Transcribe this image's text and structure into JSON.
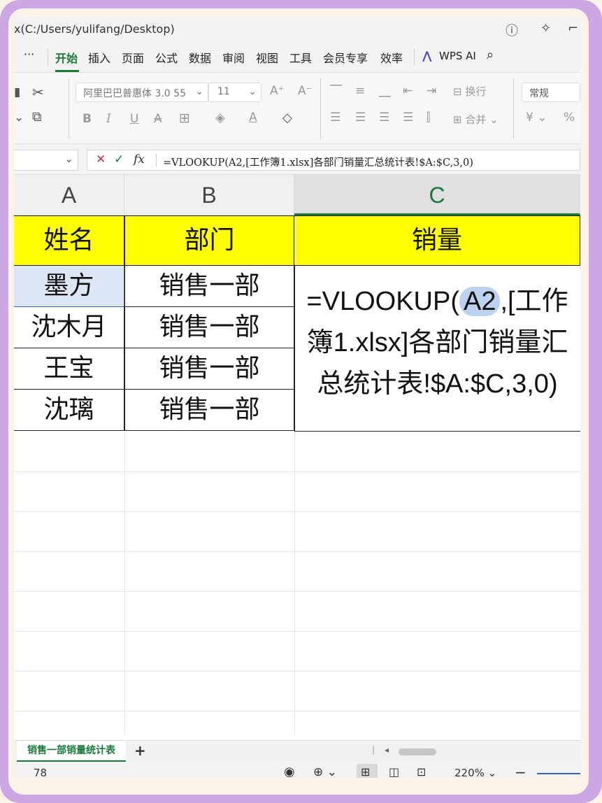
{
  "window": {
    "title": "x(C:/Users/yulifang/Desktop)"
  },
  "menu": {
    "more": "···",
    "items": [
      "开始",
      "插入",
      "页面",
      "公式",
      "数据",
      "审阅",
      "视图",
      "工具",
      "会员专享",
      "效率"
    ],
    "wps_ai": "WPS AI"
  },
  "ribbon": {
    "font_name": "阿里巴巴普惠体 3.0 55",
    "font_size": "11",
    "bold": "B",
    "italic": "I",
    "underline": "U",
    "strike": "A",
    "wrap_text": "换行",
    "merge": "合并",
    "number_format": "常规",
    "currency": "¥",
    "percent": "%"
  },
  "formula_bar": {
    "cancel": "✕",
    "confirm": "✓",
    "fx": "fx",
    "formula": "=VLOOKUP(A2,[工作簿1.xlsx]各部门销量汇总统计表!$A:$C,3,0)"
  },
  "columns": [
    "A",
    "B",
    "C"
  ],
  "headers": [
    "姓名",
    "部门",
    "销量"
  ],
  "rows": [
    {
      "name": "墨方",
      "dept": "销售一部"
    },
    {
      "name": "沈木月",
      "dept": "销售一部"
    },
    {
      "name": "王宝",
      "dept": "销售一部"
    },
    {
      "name": "沈璃",
      "dept": "销售一部"
    }
  ],
  "cell_formula": {
    "prefix": "=VLOOKUP(",
    "ref": "A2",
    "suffix_line1": ",[工作",
    "line2": "簿1.xlsx]各部门销量汇",
    "line3": "总统计表!$A:$C,3,0)"
  },
  "sheet": {
    "tab": "销售一部销量统计表",
    "add": "+"
  },
  "status": {
    "left_value": "78",
    "zoom": "220%"
  },
  "colors": {
    "accent": "#1a7a3a",
    "header_fill": "#ffff00",
    "selection": "#dce6f5",
    "ref_highlight": "#bcd3f0"
  }
}
